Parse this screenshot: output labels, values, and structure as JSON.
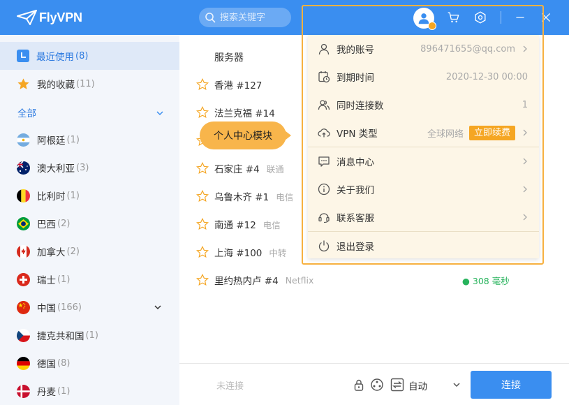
{
  "app": {
    "logo_text": "FlyVPN"
  },
  "search": {
    "placeholder": "搜索关键字"
  },
  "sidebar": {
    "recent": {
      "label": "最近使用",
      "count": "(8)"
    },
    "favorites": {
      "label": "我的收藏",
      "count": "(11)"
    },
    "all_label": "全部",
    "countries": [
      {
        "name": "阿根廷",
        "count": "(1)",
        "flag": "argentina-flag"
      },
      {
        "name": "澳大利亚",
        "count": "(3)",
        "flag": "australia-flag"
      },
      {
        "name": "比利时",
        "count": "(1)",
        "flag": "belgium-flag"
      },
      {
        "name": "巴西",
        "count": "(2)",
        "flag": "brazil-flag"
      },
      {
        "name": "加拿大",
        "count": "(2)",
        "flag": "canada-flag"
      },
      {
        "name": "瑞士",
        "count": "(1)",
        "flag": "switzerland-flag"
      },
      {
        "name": "中国",
        "count": "(166)",
        "flag": "china-flag"
      },
      {
        "name": "捷克共和国",
        "count": "(1)",
        "flag": "czech-flag"
      },
      {
        "name": "德国",
        "count": "(8)",
        "flag": "germany-flag"
      },
      {
        "name": "丹麦",
        "count": "(1)",
        "flag": "denmark-flag"
      }
    ]
  },
  "main": {
    "column_header": "服务器",
    "servers": [
      {
        "name": "香港 #127",
        "tag": ""
      },
      {
        "name": "法兰克福 #14",
        "tag": ""
      },
      {
        "name": "",
        "tag": ""
      },
      {
        "name": "石家庄 #4",
        "tag": "联通"
      },
      {
        "name": "乌鲁木齐 #1",
        "tag": "电信"
      },
      {
        "name": "南通 #12",
        "tag": "电信"
      },
      {
        "name": "上海 #100",
        "tag": "中转"
      },
      {
        "name": "里约热内卢 #4",
        "tag": "Netflix",
        "latency": "● 308 毫秒"
      }
    ]
  },
  "bottom": {
    "status": "未连接",
    "mode": "自动",
    "connect_label": "连接"
  },
  "dropdown": {
    "account": {
      "label": "我的账号",
      "value": "896471655@qq.com"
    },
    "expiry": {
      "label": "到期时间",
      "value": "2020-12-30 00:00"
    },
    "connections": {
      "label": "同时连接数",
      "value": "1"
    },
    "vpn_type": {
      "label": "VPN 类型",
      "value": "全球网络",
      "renew": "立即续费"
    },
    "messages": {
      "label": "消息中心"
    },
    "about": {
      "label": "关于我们"
    },
    "support": {
      "label": "联系客服"
    },
    "logout": {
      "label": "退出登录"
    }
  },
  "callout": {
    "text": "个人中心模块"
  },
  "colors": {
    "primary": "#3a8ef0",
    "accent": "#f5a623",
    "highlight": "#f7b140",
    "success": "#27b35c"
  }
}
